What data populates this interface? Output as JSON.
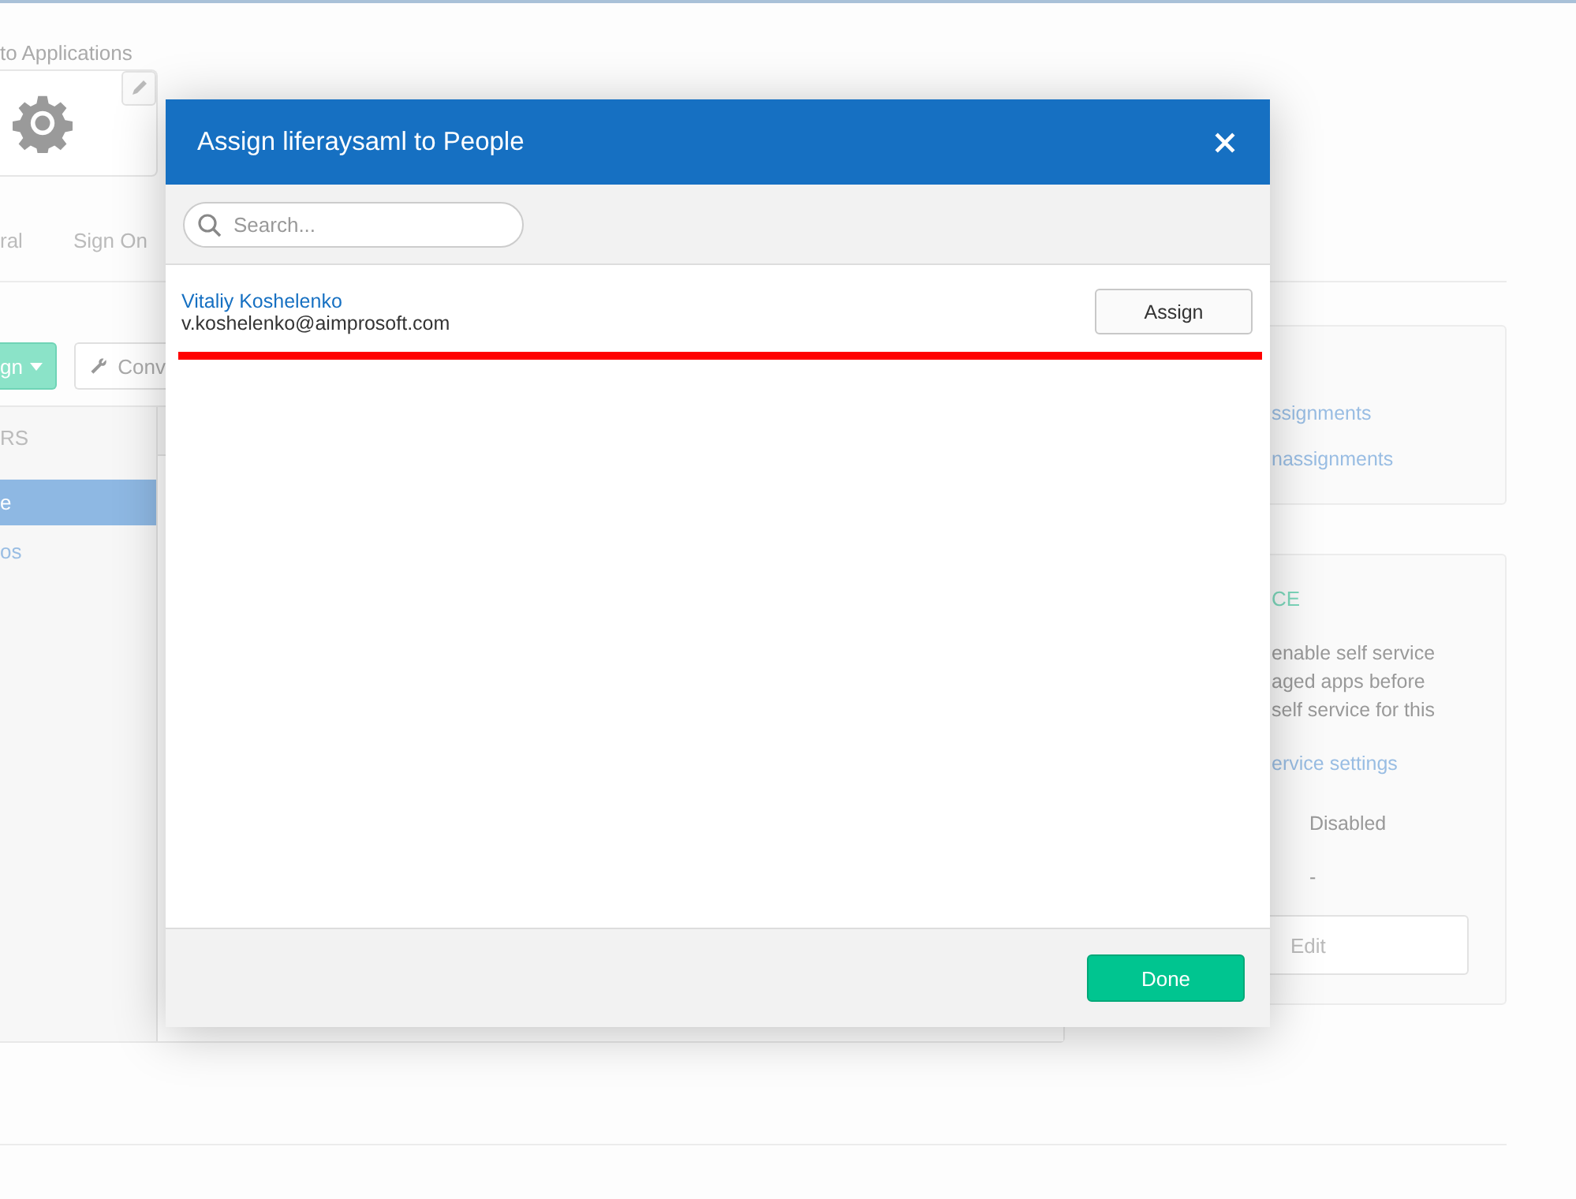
{
  "breadcrumb": "to Applications",
  "app_tabs": [
    {
      "label": "ral",
      "selected": false
    },
    {
      "label": "Sign On",
      "selected": false
    }
  ],
  "toolbar": {
    "primary_button": "gn",
    "secondary_button": "Conv"
  },
  "sidebar": {
    "heading": "RS",
    "items": [
      {
        "label": "e",
        "selected": true
      },
      {
        "label": "os",
        "selected": false
      }
    ]
  },
  "assignments_card": {
    "links": [
      "ssignments",
      "nassignments"
    ]
  },
  "self_service_card": {
    "heading": "CE",
    "description_lines": [
      "enable self service",
      "aged apps before",
      "self service for this"
    ],
    "link": "ervice settings",
    "values": [
      "Disabled",
      "-"
    ],
    "button": "Edit"
  },
  "dialog": {
    "title": "Assign liferaysaml to People",
    "search": {
      "placeholder": "Search..."
    },
    "people": [
      {
        "name": "Vitaliy Koshelenko",
        "email": "v.koshelenko@aimprosoft.com",
        "action": "Assign"
      }
    ],
    "done_button": "Done"
  }
}
